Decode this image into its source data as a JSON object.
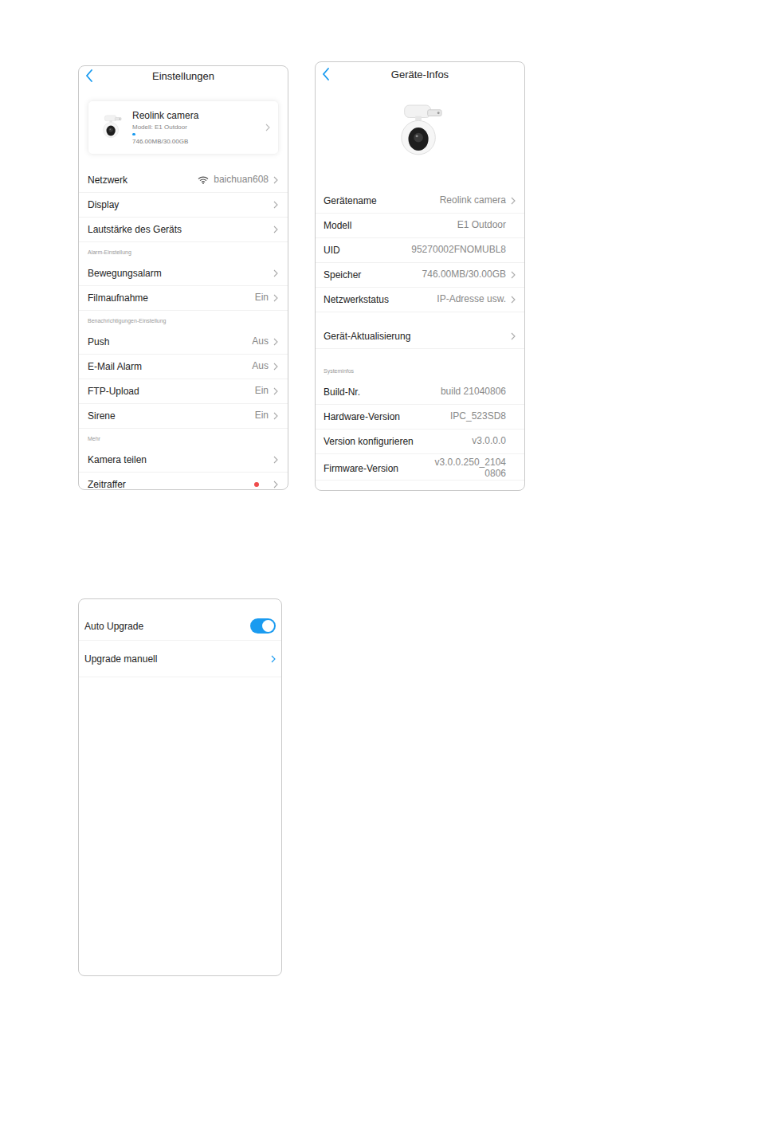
{
  "settings": {
    "title": "Einstellungen",
    "device": {
      "name": "Reolink camera",
      "model": "Modell: E1 Outdoor",
      "storage": "746.00MB/30.00GB",
      "level": 0.025
    },
    "groups": [
      {
        "label": "",
        "rows": [
          {
            "label": "Netzwerk",
            "value": "baichuan608",
            "kind": "wifi",
            "chevron": true
          },
          {
            "label": "Display",
            "value": "",
            "kind": "text",
            "chevron": true
          },
          {
            "label": "Lautstärke des Geräts",
            "value": "",
            "kind": "text",
            "chevron": true
          }
        ]
      },
      {
        "label": "Alarm-Einstellung",
        "rows": [
          {
            "label": "Bewegungsalarm",
            "value": "",
            "kind": "text",
            "chevron": true
          },
          {
            "label": "Filmaufnahme",
            "value": "Ein",
            "kind": "text",
            "chevron": true
          }
        ]
      },
      {
        "label": "Benachrichtigungen-Einstellung",
        "rows": [
          {
            "label": "Push",
            "value": "Aus",
            "kind": "text",
            "chevron": true
          },
          {
            "label": "E-Mail Alarm",
            "value": "Aus",
            "kind": "text",
            "chevron": true
          },
          {
            "label": "FTP-Upload",
            "value": "Ein",
            "kind": "text",
            "chevron": true
          },
          {
            "label": "Sirene",
            "value": "Ein",
            "kind": "text",
            "chevron": true
          }
        ]
      },
      {
        "label": "Mehr",
        "rows": [
          {
            "label": "Kamera teilen",
            "value": "",
            "kind": "text",
            "chevron": true
          },
          {
            "label": "Zeitraffer",
            "value": "",
            "kind": "dot",
            "chevron": true
          }
        ]
      }
    ]
  },
  "info": {
    "title": "Geräte-Infos",
    "groups": [
      {
        "label": "",
        "rows": [
          {
            "label": "Gerätename",
            "value": "Reolink camera",
            "kind": "text",
            "chevron": true
          },
          {
            "label": "Modell",
            "value": "E1 Outdoor",
            "kind": "text",
            "chevron": false
          },
          {
            "label": "UID",
            "value": "95270002FNOMUBL8",
            "kind": "text",
            "chevron": false
          },
          {
            "label": "Speicher",
            "value": "746.00MB/30.00GB",
            "kind": "text",
            "chevron": true
          },
          {
            "label": "Netzwerkstatus",
            "value": "IP-Adresse usw.",
            "kind": "text",
            "chevron": true
          }
        ]
      },
      {
        "label": "",
        "rows": [
          {
            "label": "Gerät-Aktualisierung",
            "value": "",
            "kind": "text",
            "chevron": true
          }
        ]
      },
      {
        "label": "Systeminfos",
        "rows": [
          {
            "label": "Build-Nr.",
            "value": "build 21040806",
            "kind": "text",
            "chevron": false
          },
          {
            "label": "Hardware-Version",
            "value": "IPC_523SD8",
            "kind": "text",
            "chevron": false
          },
          {
            "label": "Version konfigurieren",
            "value": "v3.0.0.0",
            "kind": "text",
            "chevron": false
          },
          {
            "label": "Firmware-Version",
            "value": "v3.0.0.250_21040806",
            "kind": "wrap",
            "chevron": false
          }
        ]
      }
    ]
  },
  "upgrade": {
    "rows": [
      {
        "label": "Auto Upgrade",
        "kind": "toggle",
        "on": true
      },
      {
        "label": "Upgrade manuell",
        "kind": "link",
        "on": false
      }
    ]
  }
}
